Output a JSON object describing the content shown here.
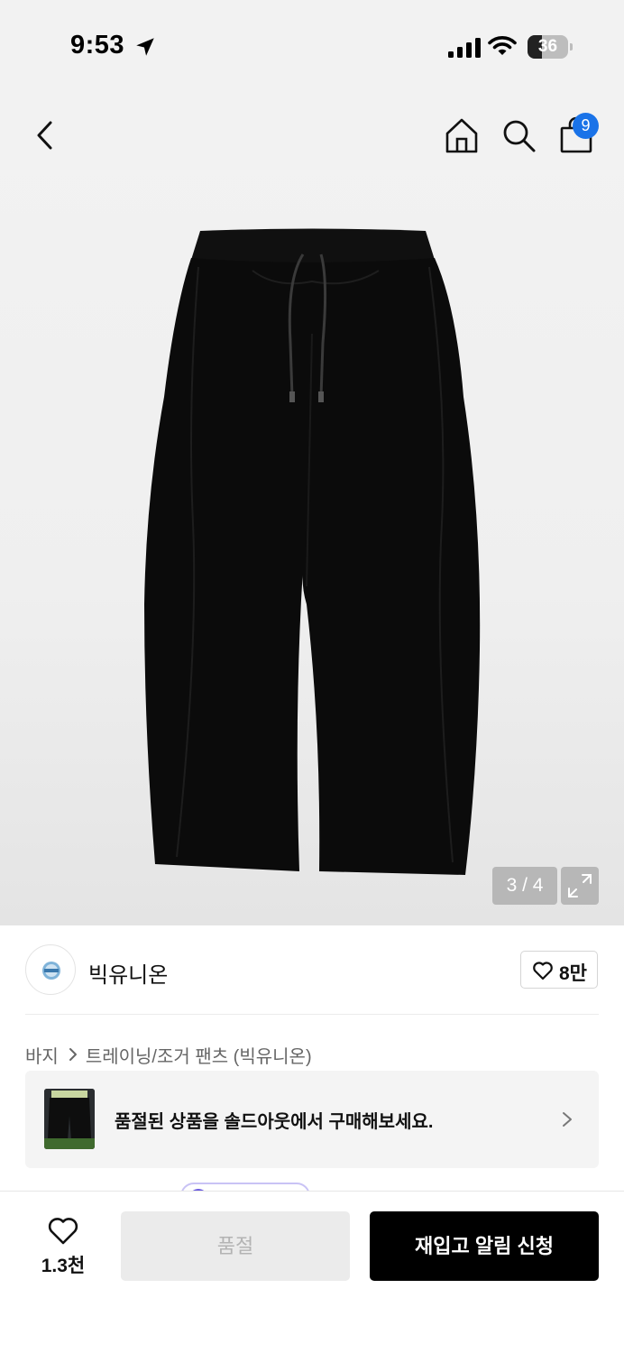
{
  "status_bar": {
    "time": "9:53",
    "battery_level": "36",
    "battery_fraction": 0.36,
    "icons": [
      "location-arrow-icon",
      "cellular-signal-icon",
      "wifi-icon",
      "battery-icon"
    ]
  },
  "header": {
    "icons": [
      "back-chevron-icon",
      "home-icon",
      "search-icon",
      "shopping-bag-icon"
    ],
    "cart_badge": "9",
    "badge_color": "#1a73e8"
  },
  "gallery": {
    "counter": "3 / 4",
    "current": 3,
    "total": 4,
    "expand_icon": "expand-arrows-icon"
  },
  "brand": {
    "name": "빅유니온",
    "like_count": "8만",
    "like_icon": "heart-outline-icon"
  },
  "breadcrumb": {
    "items": [
      "바지",
      "트레이닝/조거 팬츠 (빅유니온)"
    ],
    "separator_icon": "chevron-right-icon"
  },
  "soldout_banner": {
    "text": "품절된 상품을 솔드아웃에서 구매해보세요.",
    "chevron_icon": "chevron-right-icon"
  },
  "bottom_bar": {
    "wish_count": "1.3천",
    "wish_icon": "heart-outline-icon",
    "soldout_label": "품절",
    "restock_label": "재입고 알림 신청"
  },
  "colors": {
    "primary_button": "#000000",
    "disabled_button": "#ebebeb",
    "accent_badge": "#1a73e8"
  }
}
